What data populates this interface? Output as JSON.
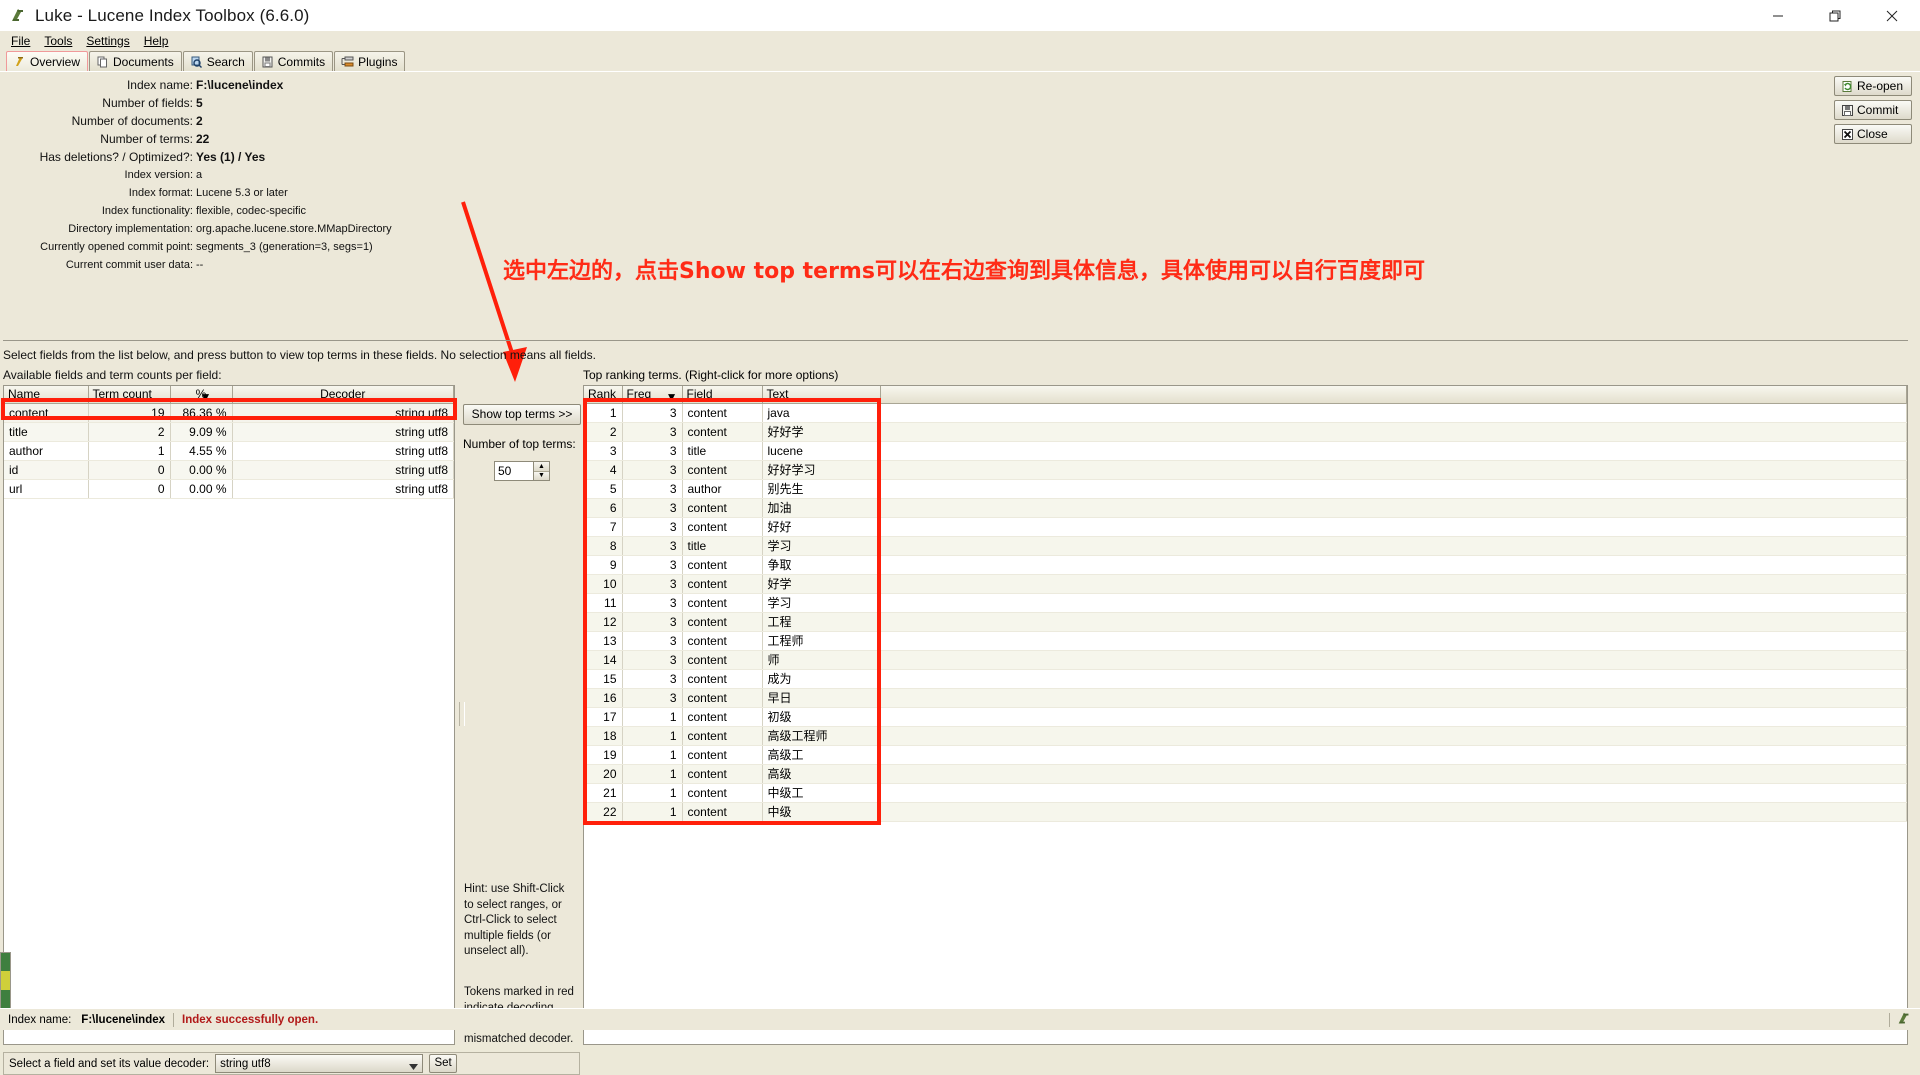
{
  "window": {
    "title": "Luke - Lucene Index Toolbox (6.6.0)",
    "app_icon": "luke-icon",
    "minimize": "minimize-icon",
    "maximize": "maximize-icon",
    "close": "close-icon"
  },
  "menu": [
    {
      "label": "File",
      "mnemonic": "F"
    },
    {
      "label": "Tools",
      "mnemonic": "T"
    },
    {
      "label": "Settings",
      "mnemonic": "S"
    },
    {
      "label": "Help",
      "mnemonic": "H"
    }
  ],
  "tabs": [
    {
      "label": "Overview",
      "icon": "overview-icon",
      "active": true
    },
    {
      "label": "Documents",
      "icon": "documents-icon",
      "active": false
    },
    {
      "label": "Search",
      "icon": "search-icon",
      "active": false
    },
    {
      "label": "Commits",
      "icon": "commits-icon",
      "active": false
    },
    {
      "label": "Plugins",
      "icon": "plugins-icon",
      "active": false
    }
  ],
  "overview": {
    "rows": [
      {
        "label": "Index name:",
        "value": "F:\\lucene\\index",
        "bold": true,
        "big": true
      },
      {
        "label": "Number of fields:",
        "value": "5",
        "bold": true,
        "big": true
      },
      {
        "label": "Number of documents:",
        "value": "2",
        "bold": true,
        "big": true
      },
      {
        "label": "Number of terms:",
        "value": "22",
        "bold": true,
        "big": true
      },
      {
        "label": "Has deletions? / Optimized?:",
        "value": "Yes (1) / Yes",
        "bold": true,
        "big": true
      },
      {
        "label": "Index version:",
        "value": "a",
        "bold": false,
        "big": false
      },
      {
        "label": "Index format:",
        "value": "Lucene 5.3 or later",
        "bold": false,
        "big": false
      },
      {
        "label": "Index functionality:",
        "value": "flexible, codec-specific",
        "bold": false,
        "big": false
      },
      {
        "label": "Directory implementation:",
        "value": "org.apache.lucene.store.MMapDirectory",
        "bold": false,
        "big": false
      },
      {
        "label": "Currently opened commit point:",
        "value": "segments_3 (generation=3, segs=1)",
        "bold": false,
        "big": false
      },
      {
        "label": "Current commit user data:",
        "value": "--",
        "bold": false,
        "big": false
      }
    ]
  },
  "corner_buttons": [
    {
      "label": "Re-open",
      "icon": "reopen-icon"
    },
    {
      "label": "Commit",
      "icon": "commit-icon"
    },
    {
      "label": "Close",
      "icon": "close-x-icon"
    }
  ],
  "annotation": {
    "text": "选中左边的，点击Show top terms可以在右边查询到具体信息，具体使用可以自行百度即可",
    "color": "#ff2b16",
    "arrow": "red-arrow"
  },
  "instructions": {
    "select_hint": "Select fields from the list below, and press button to view top terms in these fields. No selection means all fields.",
    "available_label": "Available fields and term counts per field:"
  },
  "fields_table": {
    "columns": [
      "Name",
      "Term count",
      "%",
      "Decoder"
    ],
    "sorted_column": "%",
    "sort_marker": "▼",
    "rows": [
      {
        "name": "content",
        "term_count": "19",
        "pct": "86.36 %",
        "decoder": "string utf8",
        "selected": true
      },
      {
        "name": "title",
        "term_count": "2",
        "pct": "9.09 %",
        "decoder": "string utf8",
        "selected": false
      },
      {
        "name": "author",
        "term_count": "1",
        "pct": "4.55 %",
        "decoder": "string utf8",
        "selected": false
      },
      {
        "name": "id",
        "term_count": "0",
        "pct": "0.00 %",
        "decoder": "string utf8",
        "selected": false
      },
      {
        "name": "url",
        "term_count": "0",
        "pct": "0.00 %",
        "decoder": "string utf8",
        "selected": false
      }
    ]
  },
  "middle": {
    "show_top_terms_button": "Show top terms >>",
    "number_of_top_terms_label": "Number of top terms:",
    "number_of_top_terms_value": "50",
    "spinner_up": "▲",
    "spinner_down": "▼",
    "hint1": "Hint: use Shift-Click to select ranges, or Ctrl-Click to select multiple fields (or unselect all).",
    "hint2": "Tokens marked in red indicate decoding errors, likely due to a mismatched decoder."
  },
  "terms_panel": {
    "title": "Top ranking terms. (Right-click for more options)",
    "columns": [
      "Rank",
      "Freq",
      "Field",
      "Text"
    ],
    "sorted_column": "Freq",
    "sort_marker": "▼",
    "rows": [
      {
        "rank": "1",
        "freq": "3",
        "field": "content",
        "text": "java"
      },
      {
        "rank": "2",
        "freq": "3",
        "field": "content",
        "text": "好好学"
      },
      {
        "rank": "3",
        "freq": "3",
        "field": "title",
        "text": "lucene"
      },
      {
        "rank": "4",
        "freq": "3",
        "field": "content",
        "text": "好好学习"
      },
      {
        "rank": "5",
        "freq": "3",
        "field": "author",
        "text": "别先生"
      },
      {
        "rank": "6",
        "freq": "3",
        "field": "content",
        "text": "加油"
      },
      {
        "rank": "7",
        "freq": "3",
        "field": "content",
        "text": "好好"
      },
      {
        "rank": "8",
        "freq": "3",
        "field": "title",
        "text": "学习"
      },
      {
        "rank": "9",
        "freq": "3",
        "field": "content",
        "text": "争取"
      },
      {
        "rank": "10",
        "freq": "3",
        "field": "content",
        "text": "好学"
      },
      {
        "rank": "11",
        "freq": "3",
        "field": "content",
        "text": "学习"
      },
      {
        "rank": "12",
        "freq": "3",
        "field": "content",
        "text": "工程"
      },
      {
        "rank": "13",
        "freq": "3",
        "field": "content",
        "text": "工程师"
      },
      {
        "rank": "14",
        "freq": "3",
        "field": "content",
        "text": "师"
      },
      {
        "rank": "15",
        "freq": "3",
        "field": "content",
        "text": "成为"
      },
      {
        "rank": "16",
        "freq": "3",
        "field": "content",
        "text": "早日"
      },
      {
        "rank": "17",
        "freq": "1",
        "field": "content",
        "text": "初级"
      },
      {
        "rank": "18",
        "freq": "1",
        "field": "content",
        "text": "高级工程师"
      },
      {
        "rank": "19",
        "freq": "1",
        "field": "content",
        "text": "高级工"
      },
      {
        "rank": "20",
        "freq": "1",
        "field": "content",
        "text": "高级"
      },
      {
        "rank": "21",
        "freq": "1",
        "field": "content",
        "text": "中级工"
      },
      {
        "rank": "22",
        "freq": "1",
        "field": "content",
        "text": "中级"
      }
    ]
  },
  "decoder_bar": {
    "label": "Select a field and set its value decoder:",
    "selected": "string utf8",
    "set_button": "Set"
  },
  "statusbar": {
    "index_label": "Index name:",
    "index_value": "F:\\lucene\\index",
    "message": "Index successfully open.",
    "tray_icon": "luke-icon"
  }
}
